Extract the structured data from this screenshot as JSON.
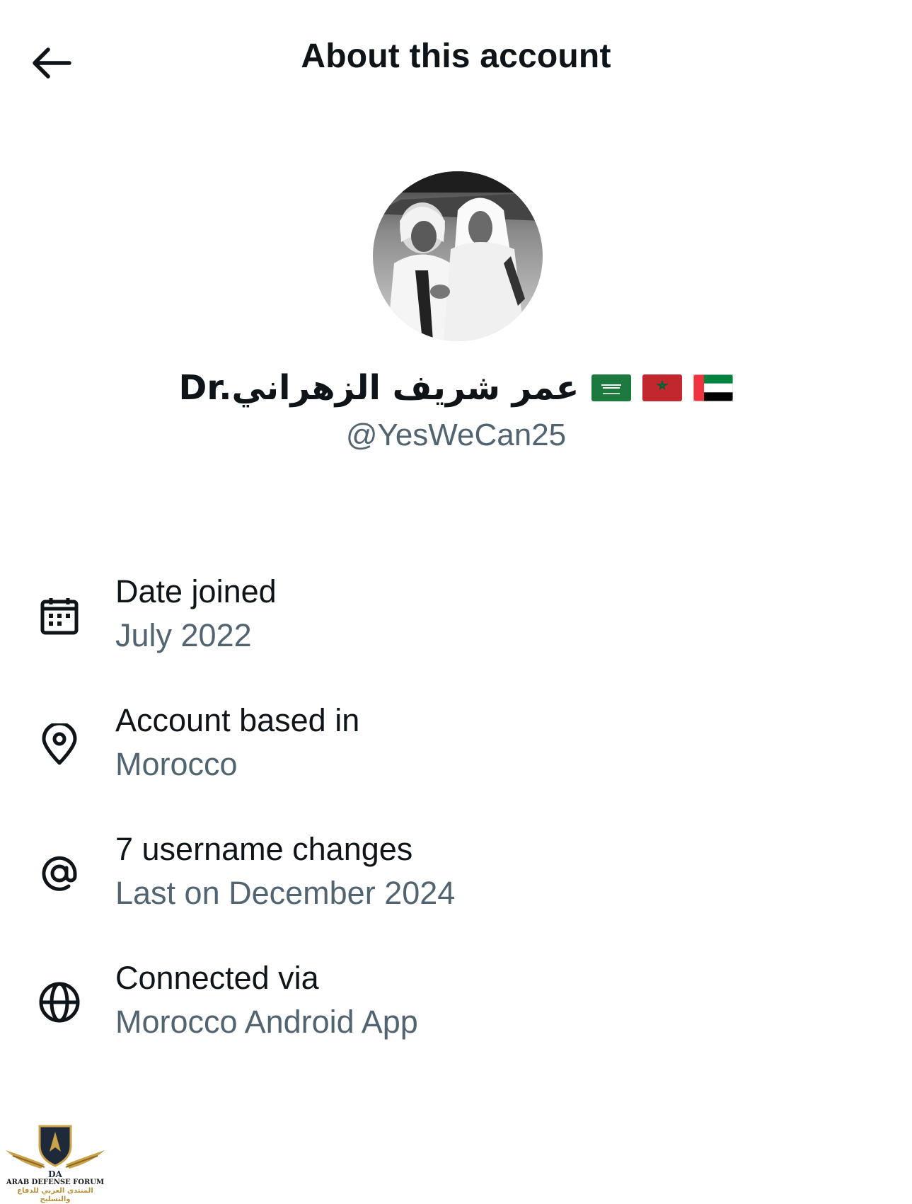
{
  "header": {
    "title": "About this account",
    "back_icon": "arrow-left-icon"
  },
  "profile": {
    "avatar_icon": "profile-avatar-photo",
    "display_name": "Dr.عمر شريف الزهراني",
    "flags": [
      "saudi-arabia-flag",
      "morocco-flag",
      "uae-flag"
    ],
    "handle": "@YesWeCan25"
  },
  "info": [
    {
      "icon": "calendar-icon",
      "label": "Date joined",
      "value": "July 2022"
    },
    {
      "icon": "location-pin-icon",
      "label": "Account based in",
      "value": "Morocco"
    },
    {
      "icon": "at-sign-icon",
      "label": "7 username changes",
      "value": "Last on December 2024"
    },
    {
      "icon": "globe-icon",
      "label": "Connected via",
      "value": "Morocco Android App"
    }
  ],
  "watermark": {
    "logo": "DA",
    "name_en": "ARAB DEFENSE FORUM",
    "name_ar": "المنتدى العربي للدفاع والتسليح"
  },
  "colors": {
    "primary_text": "#0f1419",
    "secondary_text": "#536471",
    "background": "#ffffff"
  }
}
